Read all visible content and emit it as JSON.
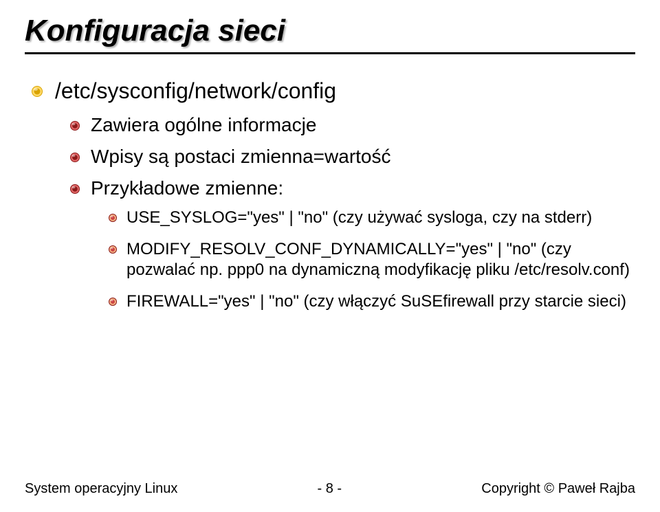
{
  "title": "Konfiguracja sieci",
  "section": {
    "heading": "/etc/sysconfig/network/config",
    "items": [
      "Zawiera ogólne informacje",
      "Wpisy są postaci zmienna=wartość",
      "Przykładowe zmienne:"
    ],
    "examples": [
      "USE_SYSLOG=\"yes\" | \"no\" (czy używać sysloga, czy na stderr)",
      "MODIFY_RESOLV_CONF_DYNAMICALLY=\"yes\" | \"no\" (czy pozwalać np. ppp0 na dynamiczną modyfikację pliku /etc/resolv.conf)",
      "FIREWALL=\"yes\" | \"no\" (czy włączyć SuSEfirewall przy starcie sieci)"
    ]
  },
  "footer": {
    "left": "System operacyjny Linux",
    "center": "- 8 -",
    "right": "Copyright © Paweł Rajba"
  },
  "colors": {
    "bullet_yellow_outer": "#d9a300",
    "bullet_yellow_inner": "#ffd966",
    "bullet_red_outer": "#8b1a1a",
    "bullet_red_inner": "#e06666",
    "bullet_small_outer": "#8b1a1a",
    "bullet_small_inner": "#f4b183"
  }
}
